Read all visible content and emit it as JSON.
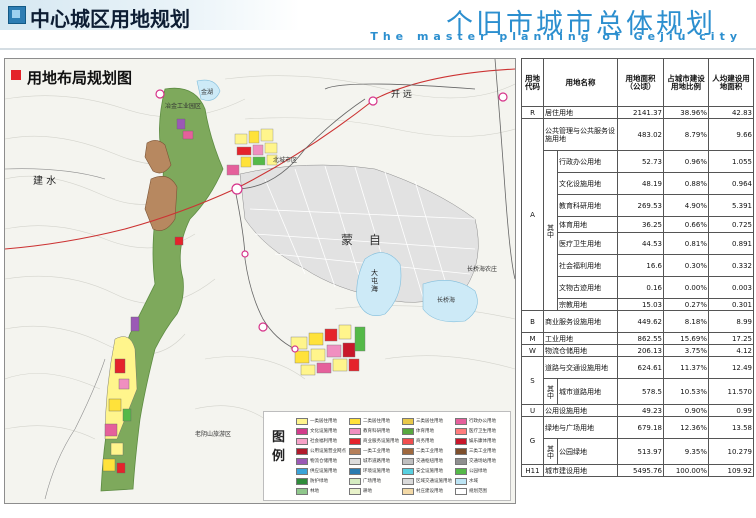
{
  "header": {
    "page_title": "中心城区用地规划",
    "title_cn": "个旧市城市总体规划",
    "title_en": "The master planning of Gejiu city"
  },
  "map": {
    "title": "用地布局规划图",
    "places": {
      "jian_shui": "建 水",
      "meng_zi": "蒙 自",
      "da_tun_hai": "大 屯 海",
      "chang_qiao_hai": "长桥海",
      "kai_yuan": "开 远",
      "jin_hu": "金湖",
      "lao_yin_shan": "老阴山旅游区",
      "song_shu_jiao": "北城市区",
      "gan_yuan": "冶金工业园区",
      "chang_guan": "长桥海农庄"
    },
    "legend": {
      "title": "图例",
      "items": [
        {
          "label": "一类居住用地",
          "color": "#fff58c"
        },
        {
          "label": "二类居住用地",
          "color": "#ffe23a"
        },
        {
          "label": "三类居住用地",
          "color": "#e8c84a"
        },
        {
          "label": "行政办公用地",
          "color": "#e5609b"
        },
        {
          "label": "文化设施用地",
          "color": "#d23c8b"
        },
        {
          "label": "教育科研用地",
          "color": "#f08fc0"
        },
        {
          "label": "体育用地",
          "color": "#58a83f"
        },
        {
          "label": "医疗卫生用地",
          "color": "#ff7d7d"
        },
        {
          "label": "社会福利用地",
          "color": "#f7a3c8"
        },
        {
          "label": "商业服务设施用地",
          "color": "#e5232b"
        },
        {
          "label": "商务用地",
          "color": "#f04e4e"
        },
        {
          "label": "娱乐康体用地",
          "color": "#c8172a"
        },
        {
          "label": "公用设施营业网点",
          "color": "#b01a2b"
        },
        {
          "label": "一类工业用地",
          "color": "#b6805a"
        },
        {
          "label": "二类工业用地",
          "color": "#a0693e"
        },
        {
          "label": "三类工业用地",
          "color": "#7e4f2c"
        },
        {
          "label": "物流仓储用地",
          "color": "#9b59b6"
        },
        {
          "label": "城市道路用地",
          "color": "#dcdcdc"
        },
        {
          "label": "交通枢纽用地",
          "color": "#bfbfbf"
        },
        {
          "label": "交通场站用地",
          "color": "#8f8f8f"
        },
        {
          "label": "供应设施用地",
          "color": "#3aa3d8"
        },
        {
          "label": "环境设施用地",
          "color": "#2a7bb0"
        },
        {
          "label": "安全设施用地",
          "color": "#58d0e0"
        },
        {
          "label": "公园绿地",
          "color": "#54b948"
        },
        {
          "label": "防护绿地",
          "color": "#2f8c3a"
        },
        {
          "label": "广场用地",
          "color": "#d5ecc0"
        },
        {
          "label": "区域交通设施用地",
          "color": "#d9d9d9"
        },
        {
          "label": "水域",
          "color": "#bde5f5"
        },
        {
          "label": "林地",
          "color": "#8fc78b"
        },
        {
          "label": "耕地",
          "color": "#e8f2c9"
        },
        {
          "label": "村庄建设用地",
          "color": "#f3d9a6"
        },
        {
          "label": "规划范围",
          "color": "#ffffff"
        }
      ]
    }
  },
  "table": {
    "headers": [
      "用地代码",
      "用地名称",
      "用地面积（公顷）",
      "占城市建设用地比例",
      "人均建设用地面积"
    ],
    "rows": [
      {
        "code": "R",
        "name": "居住用地",
        "area": "2141.37",
        "ratio": "38.96%",
        "per_capita": "42.83"
      },
      {
        "code": "A",
        "name": "公共管理与公共服务设施用地",
        "area": "483.02",
        "ratio": "8.79%",
        "per_capita": "9.66"
      },
      {
        "sub": "行政办公用地",
        "area": "52.73",
        "ratio": "0.96%",
        "per_capita": "1.055"
      },
      {
        "sub": "文化设施用地",
        "area": "48.19",
        "ratio": "0.88%",
        "per_capita": "0.964"
      },
      {
        "sub": "教育科研用地",
        "area": "269.53",
        "ratio": "4.90%",
        "per_capita": "5.391"
      },
      {
        "sub": "体育用地",
        "area": "36.25",
        "ratio": "0.66%",
        "per_capita": "0.725"
      },
      {
        "sub": "医疗卫生用地",
        "area": "44.53",
        "ratio": "0.81%",
        "per_capita": "0.891"
      },
      {
        "sub": "社会福利用地",
        "area": "16.6",
        "ratio": "0.30%",
        "per_capita": "0.332"
      },
      {
        "sub": "文物古迹用地",
        "area": "0.16",
        "ratio": "0.00%",
        "per_capita": "0.003"
      },
      {
        "sub": "宗教用地",
        "area": "15.03",
        "ratio": "0.27%",
        "per_capita": "0.301"
      },
      {
        "code": "B",
        "name": "商业服务设施用地",
        "area": "449.62",
        "ratio": "8.18%",
        "per_capita": "8.99"
      },
      {
        "code": "M",
        "name": "工业用地",
        "area": "862.55",
        "ratio": "15.69%",
        "per_capita": "17.25"
      },
      {
        "code": "W",
        "name": "物流仓储用地",
        "area": "206.13",
        "ratio": "3.75%",
        "per_capita": "4.12"
      },
      {
        "code": "S",
        "name": "道路与交通设施用地",
        "area": "624.61",
        "ratio": "11.37%",
        "per_capita": "12.49"
      },
      {
        "sub": "城市道路用地",
        "area": "578.5",
        "ratio": "10.53%",
        "per_capita": "11.570"
      },
      {
        "code": "U",
        "name": "公用设施用地",
        "area": "49.23",
        "ratio": "0.90%",
        "per_capita": "0.99"
      },
      {
        "code": "G",
        "name": "绿地与广场用地",
        "area": "679.18",
        "ratio": "12.36%",
        "per_capita": "13.58"
      },
      {
        "sub": "公园绿地",
        "area": "513.97",
        "ratio": "9.35%",
        "per_capita": "10.279"
      },
      {
        "code": "H11",
        "name": "城市建设用地",
        "area": "5495.76",
        "ratio": "100.00%",
        "per_capita": "109.92"
      }
    ],
    "qi_zhong": "其中"
  }
}
